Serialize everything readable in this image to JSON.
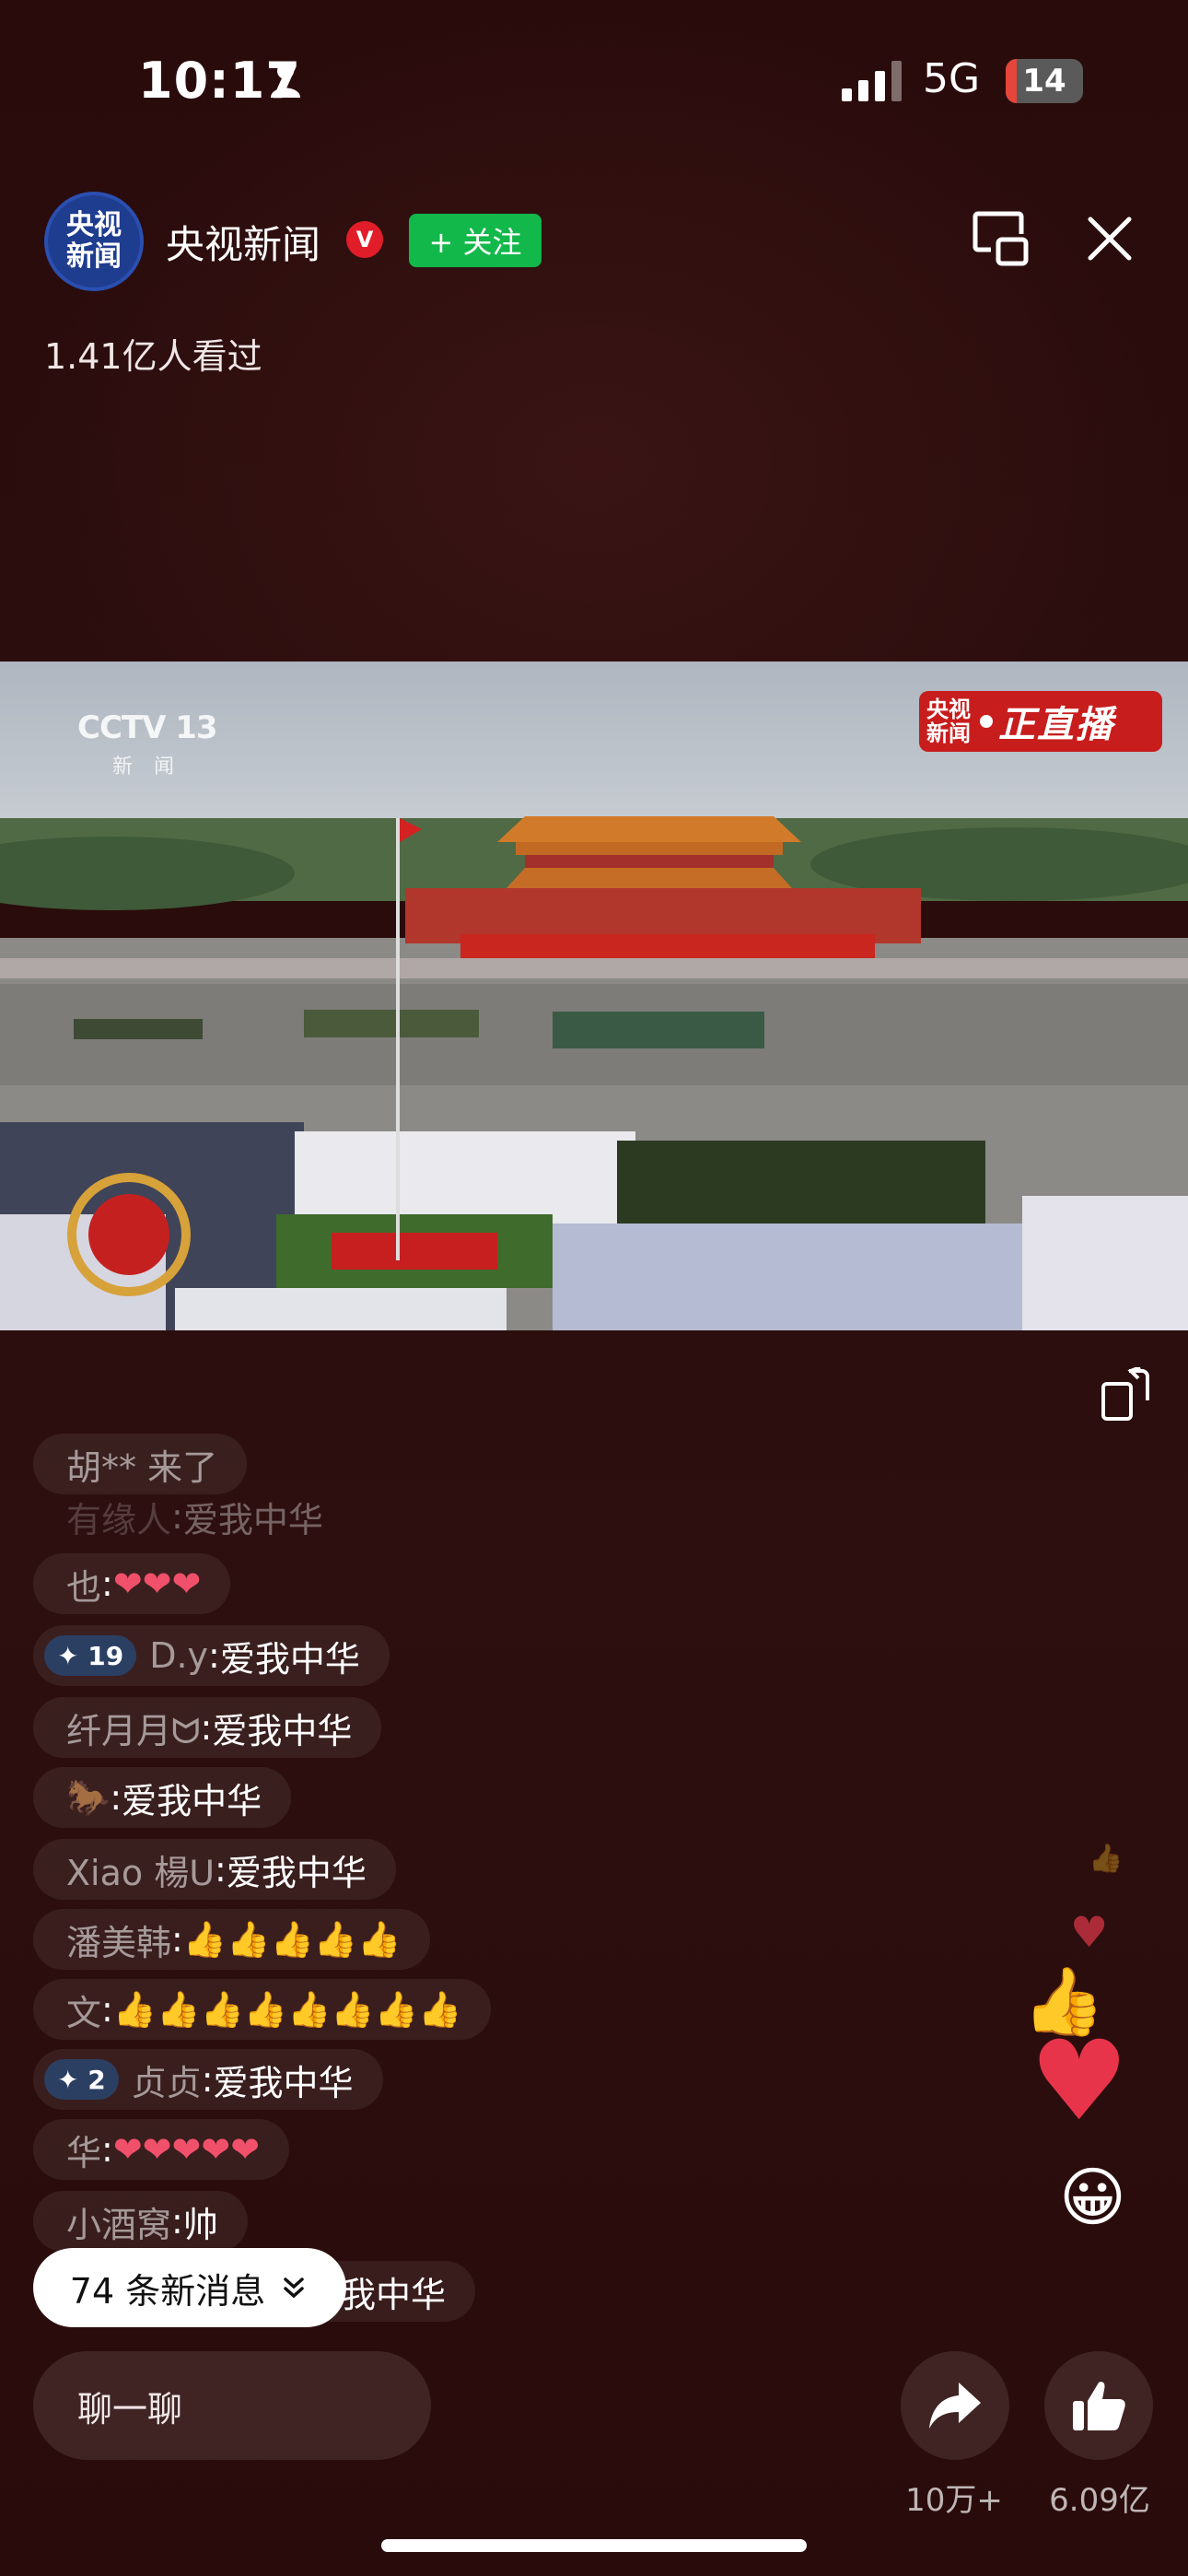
{
  "status": {
    "time": "10:17",
    "network": "5G",
    "battery": "14",
    "battery_level": 0.14
  },
  "header": {
    "avatar_text_line1": "央视",
    "avatar_text_line2": "新闻",
    "channel_name": "央视新闻",
    "verified_badge": "V",
    "follow_label": "+ 关注",
    "views": "1.41亿人看过"
  },
  "video": {
    "watermark": "CCTV 13",
    "watermark_sub": "新 闻",
    "live_badge_org_line1": "央视",
    "live_badge_org_line2": "新闻",
    "live_badge_label": "正直播"
  },
  "comments": [
    {
      "name": "胡** 来了",
      "text": "",
      "badge": ""
    },
    {
      "name": "有缘人",
      "text": "爱我中华",
      "badge": ""
    },
    {
      "name": "也",
      "text": "❤❤❤",
      "badge": ""
    },
    {
      "name": "D.y",
      "text": "爱我中华",
      "badge": "✦ 19"
    },
    {
      "name": "纤月月ᗢ",
      "text": "爱我中华",
      "badge": ""
    },
    {
      "name": "🐎",
      "text": "爱我中华",
      "badge": ""
    },
    {
      "name": "Xiao 楊ᑌ",
      "text": "爱我中华",
      "badge": ""
    },
    {
      "name": "潘美韩",
      "text": "👍👍👍👍👍",
      "badge": ""
    },
    {
      "name": "文",
      "text": "👍👍👍👍👍👍👍👍",
      "badge": ""
    },
    {
      "name": "贞贞",
      "text": "爱我中华",
      "badge": "✦ 2"
    },
    {
      "name": "华",
      "text": "❤❤❤❤❤",
      "badge": ""
    },
    {
      "name": "小酒窝",
      "text": "帅",
      "badge": ""
    },
    {
      "name": "",
      "text": "我中华",
      "badge": ""
    }
  ],
  "new_messages": "74 条新消息",
  "bottom": {
    "chat_placeholder": "聊一聊",
    "share_count": "10万+",
    "like_count": "6.09亿"
  },
  "colors": {
    "follow_green": "#12b84a",
    "live_red": "#c81d1d",
    "verify_red": "#e21d2a"
  }
}
